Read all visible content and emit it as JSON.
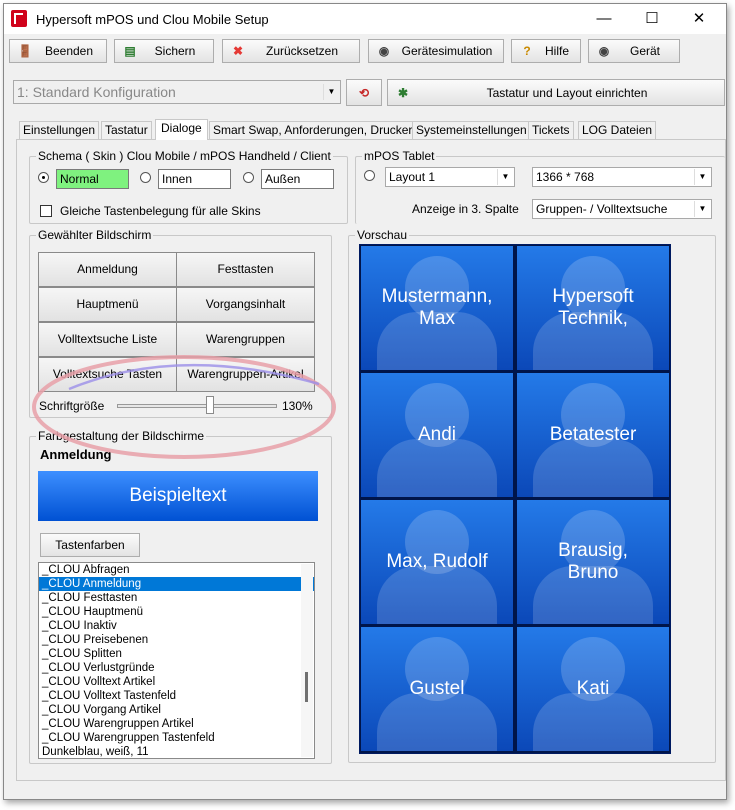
{
  "window": {
    "title": "Hypersoft mPOS und Clou Mobile Setup",
    "minimize": "—",
    "maximize": "☐",
    "close": "✕"
  },
  "toolbar": {
    "beenden": "Beenden",
    "sichern": "Sichern",
    "zuruecksetzen": "Zurücksetzen",
    "geraetesimulation": "Gerätesimulation",
    "hilfe": "Hilfe",
    "geraet": "Gerät"
  },
  "config_select": {
    "value": "1: Standard Konfiguration"
  },
  "tastatur_button": "Tastatur und Layout einrichten",
  "tabs": [
    "Einstellungen",
    "Tastatur",
    "Dialoge",
    "Smart Swap, Anforderungen, Drucker",
    "Systemeinstellungen",
    "Tickets",
    "LOG Dateien"
  ],
  "active_tab": "Dialoge",
  "schema": {
    "label": "Schema ( Skin ) Clou Mobile / mPOS Handheld / Client",
    "normal": "Normal",
    "innen": "Innen",
    "aussen": "Außen",
    "same_keys_label": "Gleiche Tastenbelegung für alle Skins"
  },
  "tablet": {
    "label": "mPOS Tablet",
    "layout": "Layout 1",
    "resolution": "1366 * 768",
    "anzeige_label": "Anzeige in 3. Spalte",
    "anzeige_value": "Gruppen- / Volltextsuche"
  },
  "screens": {
    "label": "Gewählter Bildschirm",
    "buttons": [
      "Anmeldung",
      "Festtasten",
      "Hauptmenü",
      "Vorgangsinhalt",
      "Volltextsuche Liste",
      "Warengruppen",
      "Volltextsuche Tasten",
      "Warengruppen-Artikel"
    ],
    "font_label": "Schriftgröße",
    "font_value": "130%",
    "font_level_percent": 130
  },
  "colors_group": {
    "label": "Farbgestaltung der Bildschirme",
    "current": "Anmeldung",
    "sample_text": "Beispieltext",
    "keycolors_button": "Tastenfarben",
    "items": [
      "_CLOU Abfragen",
      "_CLOU Anmeldung",
      "_CLOU Festtasten",
      "_CLOU Hauptmenü",
      "_CLOU Inaktiv",
      "_CLOU Preisebenen",
      "_CLOU Splitten",
      "_CLOU Verlustgründe",
      "_CLOU Volltext Artikel",
      "_CLOU Volltext Tastenfeld",
      "_CLOU Vorgang Artikel",
      "_CLOU Warengruppen Artikel",
      "_CLOU Warengruppen Tastenfeld",
      "Dunkelblau, weiß, 11"
    ],
    "selected": "_CLOU Anmeldung"
  },
  "preview": {
    "label": "Vorschau",
    "tiles": [
      "Mustermann,\nMax",
      "Hypersoft\nTechnik,",
      "Andi",
      "Betatester",
      "Max, Rudolf",
      "Brausig,\nBruno",
      "Gustel",
      "Kati"
    ]
  },
  "colors": {
    "accent": "#0078d7",
    "tile_blue": "#1560d6",
    "highlight_green": "#7ff27f"
  }
}
